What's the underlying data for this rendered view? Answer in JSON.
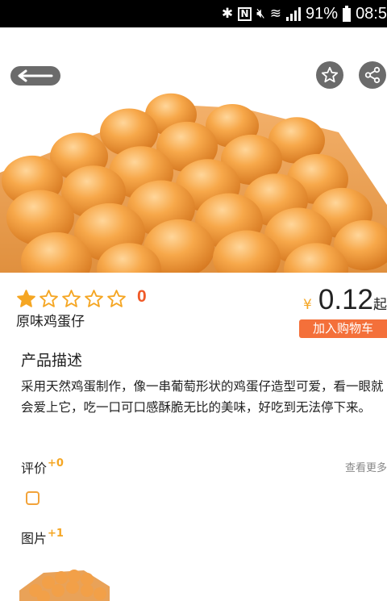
{
  "status_bar": {
    "battery": "91%",
    "time": "08:5"
  },
  "colors": {
    "accent": "#f4703a",
    "star": "#f5a623",
    "rating": "#f05a28"
  },
  "icons": {
    "back": "back-arrow-icon",
    "favorite": "star-outline-icon",
    "share": "share-icon"
  },
  "product": {
    "rating_count": "0",
    "rating_stars": 1,
    "rating_max": 5,
    "name": "原味鸡蛋仔",
    "currency": "¥",
    "price": "0.12",
    "price_suffix": "起",
    "add_to_cart": "加入购物车"
  },
  "description": {
    "title": "产品描述",
    "text": "采用天然鸡蛋制作，像一串葡萄形状的鸡蛋仔造型可爱，看一眼就会爱上它，吃一口可口感酥脆无比的美味，好吃到无法停下来。"
  },
  "reviews": {
    "label": "评价",
    "count": "+0",
    "view_more": "查看更多"
  },
  "images": {
    "label": "图片",
    "count": "+1"
  }
}
